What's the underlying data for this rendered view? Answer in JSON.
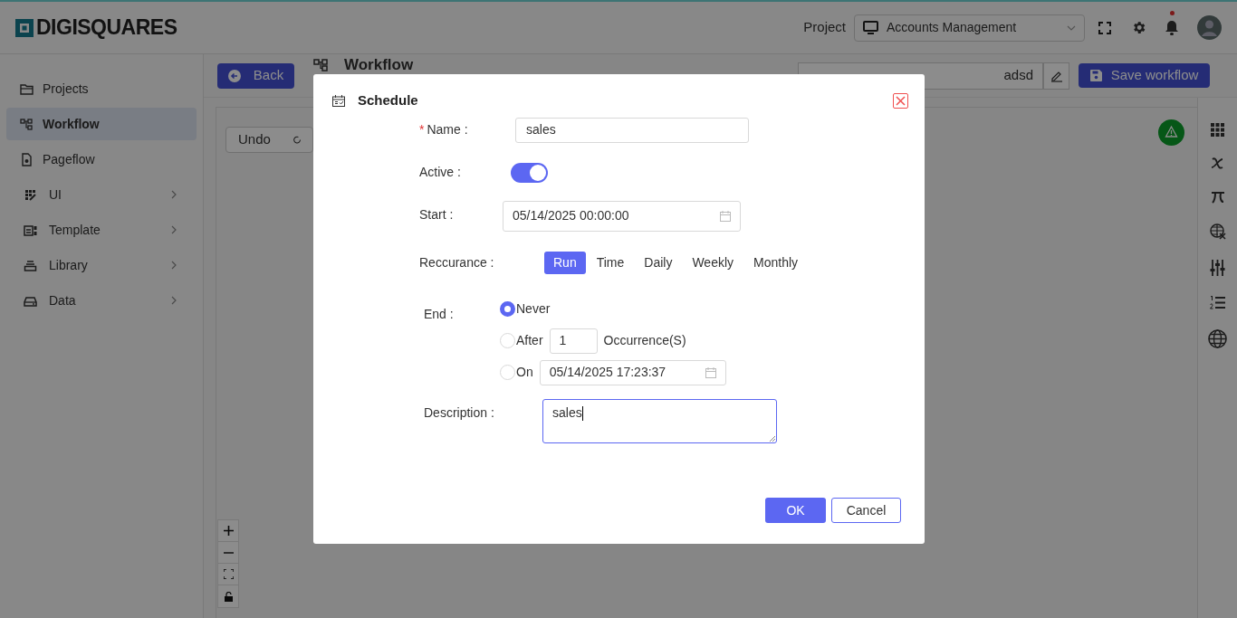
{
  "header": {
    "logo": "DIGISQUARES",
    "project_label": "Project",
    "project_select": "Accounts Management",
    "notification_dot": true
  },
  "sidebar": {
    "items": [
      {
        "label": "Projects",
        "selected": false,
        "expandable": false
      },
      {
        "label": "Workflow",
        "selected": true,
        "expandable": false
      },
      {
        "label": "Pageflow",
        "selected": false,
        "expandable": false
      },
      {
        "label": "UI",
        "selected": false,
        "expandable": true
      },
      {
        "label": "Template",
        "selected": false,
        "expandable": true
      },
      {
        "label": "Library",
        "selected": false,
        "expandable": true
      },
      {
        "label": "Data",
        "selected": false,
        "expandable": true
      }
    ]
  },
  "toolbar": {
    "back": "Back",
    "title": "Workflow",
    "name_value": "adsd",
    "save": "Save workflow"
  },
  "canvas": {
    "undo": "Undo"
  },
  "dialog": {
    "title": "Schedule",
    "name": {
      "required_mark": "*",
      "label": "Name :",
      "value": "sales"
    },
    "active": {
      "label": "Active :",
      "on": true
    },
    "start": {
      "label": "Start :",
      "value": "05/14/2025 00:00:00"
    },
    "recurrence": {
      "label": "Reccurance :",
      "options": [
        {
          "label": "Run",
          "selected": true
        },
        {
          "label": "Time",
          "selected": false
        },
        {
          "label": "Daily",
          "selected": false
        },
        {
          "label": "Weekly",
          "selected": false
        },
        {
          "label": "Monthly",
          "selected": false
        }
      ]
    },
    "end": {
      "label": "End :",
      "options": [
        {
          "kind": "plain",
          "label": "Never",
          "selected": true
        },
        {
          "kind": "count",
          "label": "After",
          "value": "1",
          "suffix": "Occurrence(S)",
          "selected": false
        },
        {
          "kind": "date",
          "label": "On",
          "value": "05/14/2025 17:23:37",
          "selected": false
        }
      ]
    },
    "description": {
      "label": "Description :",
      "value": "sales"
    },
    "ok": "OK",
    "cancel": "Cancel"
  }
}
